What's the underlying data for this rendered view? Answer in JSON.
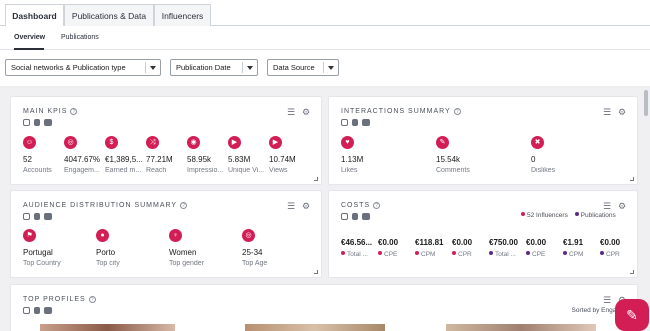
{
  "tabs": [
    "Dashboard",
    "Publications & Data",
    "Influencers"
  ],
  "subtabs": [
    "Overview",
    "Publications"
  ],
  "filters": [
    "Social networks & Publication type",
    "Publication Date",
    "Data Source"
  ],
  "main_kpis": {
    "title": "MAIN KPIS",
    "items": [
      {
        "value": "52",
        "label": "Accounts",
        "icon": "user-icon"
      },
      {
        "value": "4047.67%",
        "label": "Engagem...",
        "icon": "target-icon"
      },
      {
        "value": "€1,389,5...",
        "label": "Earned m...",
        "icon": "dollar-icon"
      },
      {
        "value": "77.21M",
        "label": "Reach",
        "icon": "shuffle-icon"
      },
      {
        "value": "58.95k",
        "label": "Impressio...",
        "icon": "eye-icon"
      },
      {
        "value": "5.83M",
        "label": "Unique Vi...",
        "icon": "play-icon"
      },
      {
        "value": "10.74M",
        "label": "Views",
        "icon": "play-icon"
      }
    ]
  },
  "interactions": {
    "title": "INTERACTIONS SUMMARY",
    "items": [
      {
        "value": "1.13M",
        "label": "Likes",
        "icon": "heart-icon"
      },
      {
        "value": "15.54k",
        "label": "Comments",
        "icon": "comment-icon"
      },
      {
        "value": "0",
        "label": "Dislikes",
        "icon": "dislike-icon"
      }
    ]
  },
  "audience": {
    "title": "AUDIENCE DISTRIBUTION SUMMARY",
    "items": [
      {
        "value": "Portugal",
        "label": "Top Country",
        "icon": "flag-icon"
      },
      {
        "value": "Porto",
        "label": "Top city",
        "icon": "pin-icon"
      },
      {
        "value": "Women",
        "label": "Top gender",
        "icon": "gender-icon"
      },
      {
        "value": "25-34",
        "label": "Top Age",
        "icon": "target-icon"
      }
    ]
  },
  "costs": {
    "title": "COSTS",
    "legend": [
      "52 Influencers",
      "Publications"
    ],
    "colors": {
      "influencers": "#d21e55",
      "publications": "#5b2a86"
    },
    "items": [
      {
        "value": "€46.56...",
        "label": "Total ...",
        "color": "#d21e55"
      },
      {
        "value": "€0.00",
        "label": "CPE",
        "color": "#d21e55"
      },
      {
        "value": "€118.81",
        "label": "CPM",
        "color": "#d21e55"
      },
      {
        "value": "€0.00",
        "label": "CPR",
        "color": "#d21e55"
      },
      {
        "value": "€750.00",
        "label": "Total ...",
        "color": "#5b2a86"
      },
      {
        "value": "€0.00",
        "label": "CPE",
        "color": "#5b2a86"
      },
      {
        "value": "€1.91",
        "label": "CPM",
        "color": "#5b2a86"
      },
      {
        "value": "€0.00",
        "label": "CPR",
        "color": "#5b2a86"
      }
    ]
  },
  "top_profiles": {
    "title": "TOP PROFILES",
    "sorted_by": "Sorted by Engagem"
  },
  "accent": "#d21e55"
}
